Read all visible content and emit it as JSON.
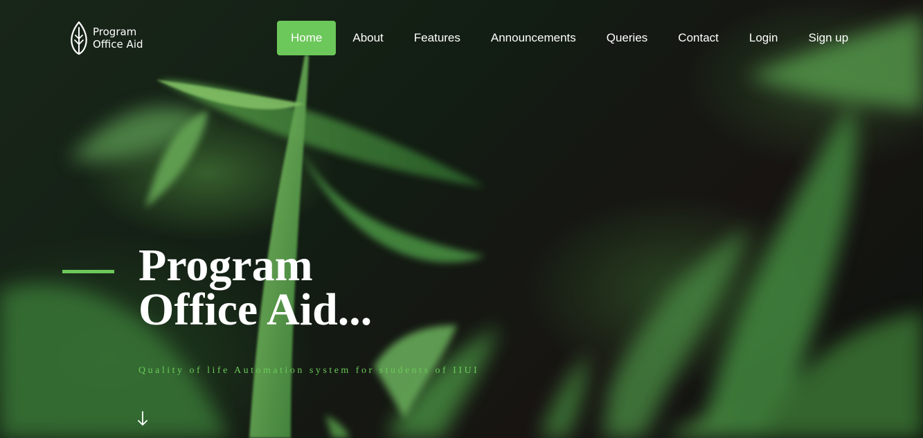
{
  "brand": {
    "name": "Program Office Aid",
    "icon": "leaf-icon"
  },
  "nav": {
    "items": [
      {
        "label": "Home",
        "active": true
      },
      {
        "label": "About",
        "active": false
      },
      {
        "label": "Features",
        "active": false
      },
      {
        "label": "Announcements",
        "active": false
      },
      {
        "label": "Queries",
        "active": false
      },
      {
        "label": "Contact",
        "active": false
      },
      {
        "label": "Login",
        "active": false
      },
      {
        "label": "Sign up",
        "active": false
      }
    ]
  },
  "hero": {
    "title": "Program Office Aid...",
    "subtitle": "Quality of life Automation system for students of IIUI",
    "scroll_icon": "arrow-down-icon"
  },
  "colors": {
    "accent": "#6cc85a",
    "text": "#ffffff",
    "background": "#16201a"
  }
}
